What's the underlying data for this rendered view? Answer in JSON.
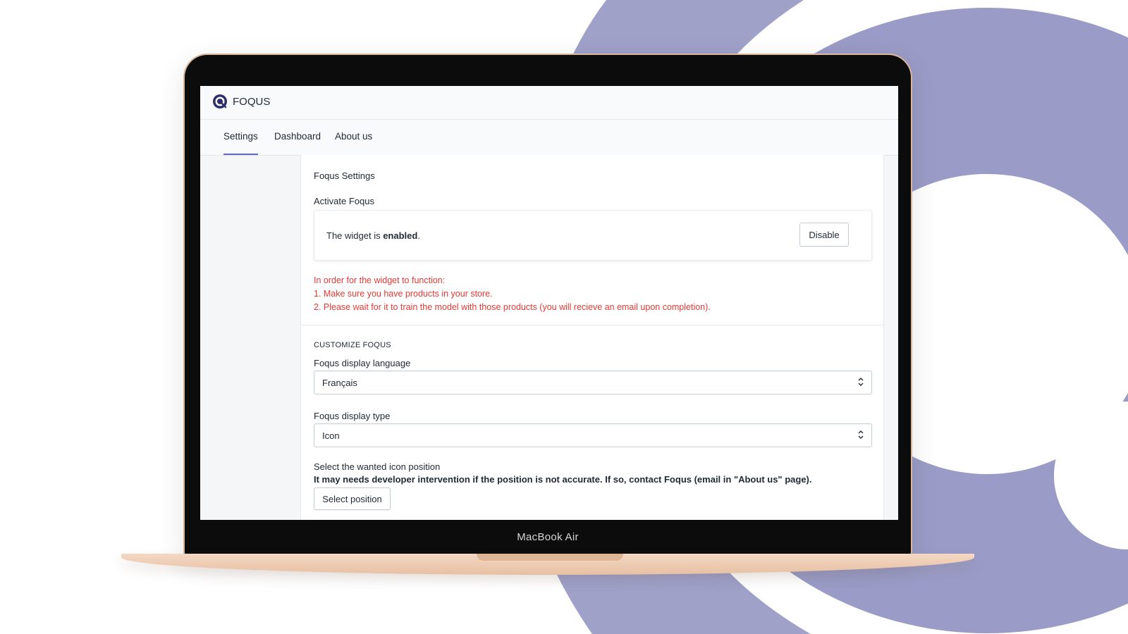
{
  "device": {
    "label": "MacBook Air"
  },
  "colors": {
    "accent": "#5c6ac4",
    "warning": "#e53935",
    "background_shape": "#9fa1c9"
  },
  "app": {
    "name": "FOQUS",
    "logo_icon": "foqus-logo-icon"
  },
  "tabs": [
    {
      "label": "Settings",
      "active": true
    },
    {
      "label": "Dashboard",
      "active": false
    },
    {
      "label": "About us",
      "active": false
    }
  ],
  "settings": {
    "section_title": "Foqus Settings",
    "activate_label": "Activate Foqus",
    "widget_status_prefix": "The widget is ",
    "widget_status_value": "enabled",
    "widget_status_suffix": ".",
    "disable_button": "Disable",
    "warning_lines": [
      "In order for the widget to function:",
      "1. Make sure you have products in your store.",
      "2. Please wait for it to train the model with those products (you will recieve an email upon completion)."
    ]
  },
  "customize": {
    "heading": "CUSTOMIZE FOQUS",
    "language_label": "Foqus display language",
    "language_value": "Français",
    "type_label": "Foqus display type",
    "type_value": "Icon",
    "position_label": "Select the wanted icon position",
    "position_note": "It may needs developer intervention if the position is not accurate. If so, contact Foqus (email in \"About us\" page).",
    "position_button": "Select position"
  }
}
